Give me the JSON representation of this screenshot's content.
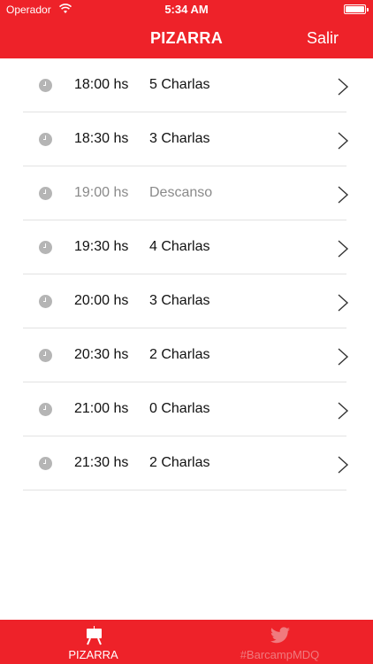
{
  "status_bar": {
    "carrier": "Operador",
    "time": "5:34 AM"
  },
  "nav": {
    "title": "PIZARRA",
    "right_button": "Salir"
  },
  "schedule": [
    {
      "time": "18:00 hs",
      "label": "5 Charlas",
      "muted": false
    },
    {
      "time": "18:30 hs",
      "label": "3 Charlas",
      "muted": false
    },
    {
      "time": "19:00 hs",
      "label": "Descanso",
      "muted": true
    },
    {
      "time": "19:30 hs",
      "label": "4 Charlas",
      "muted": false
    },
    {
      "time": "20:00 hs",
      "label": "3 Charlas",
      "muted": false
    },
    {
      "time": "20:30 hs",
      "label": "2 Charlas",
      "muted": false
    },
    {
      "time": "21:00 hs",
      "label": "0 Charlas",
      "muted": false
    },
    {
      "time": "21:30 hs",
      "label": "2 Charlas",
      "muted": false
    }
  ],
  "tabs": [
    {
      "label": "PIZARRA",
      "icon": "easel-icon",
      "active": true
    },
    {
      "label": "#BarcampMDQ",
      "icon": "twitter-bird-icon",
      "active": false
    }
  ],
  "colors": {
    "brand_red": "#ee2229",
    "separator": "#e2e2e2",
    "clock_icon": "#b5b5b5",
    "inactive_tab": "#f07a7e"
  }
}
